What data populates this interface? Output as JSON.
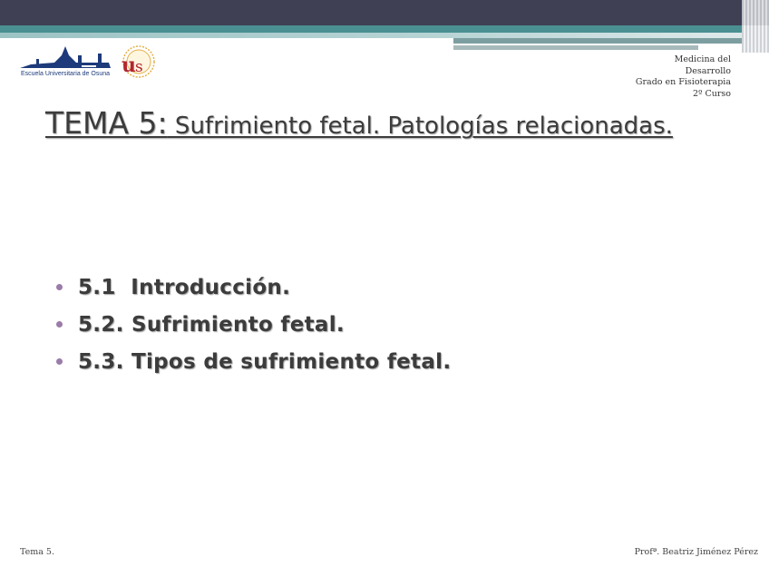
{
  "header": {
    "institution_logo_text": "Escuela Universitaria de Osuna",
    "university_logo_text": "US",
    "course_lines": [
      "Medicina del",
      "Desarrollo",
      "Grado en Fisioterapia",
      "2º Curso"
    ]
  },
  "slide": {
    "title_prefix": "TEMA 5:",
    "title_rest": " Sufrimiento fetal. Patologías relacionadas.",
    "bullets": [
      "5.1  Introducción.",
      "5.2. Sufrimiento fetal.",
      "5.3. Tipos de sufrimiento fetal."
    ]
  },
  "footer": {
    "left": "Tema 5.",
    "right": "Profª. Beatriz Jiménez Pérez"
  },
  "colors": {
    "top_bar": "#3f4054",
    "teal_band": "#4a8f92",
    "bullet": "#9b7ca8",
    "text": "#3c3c3c"
  }
}
